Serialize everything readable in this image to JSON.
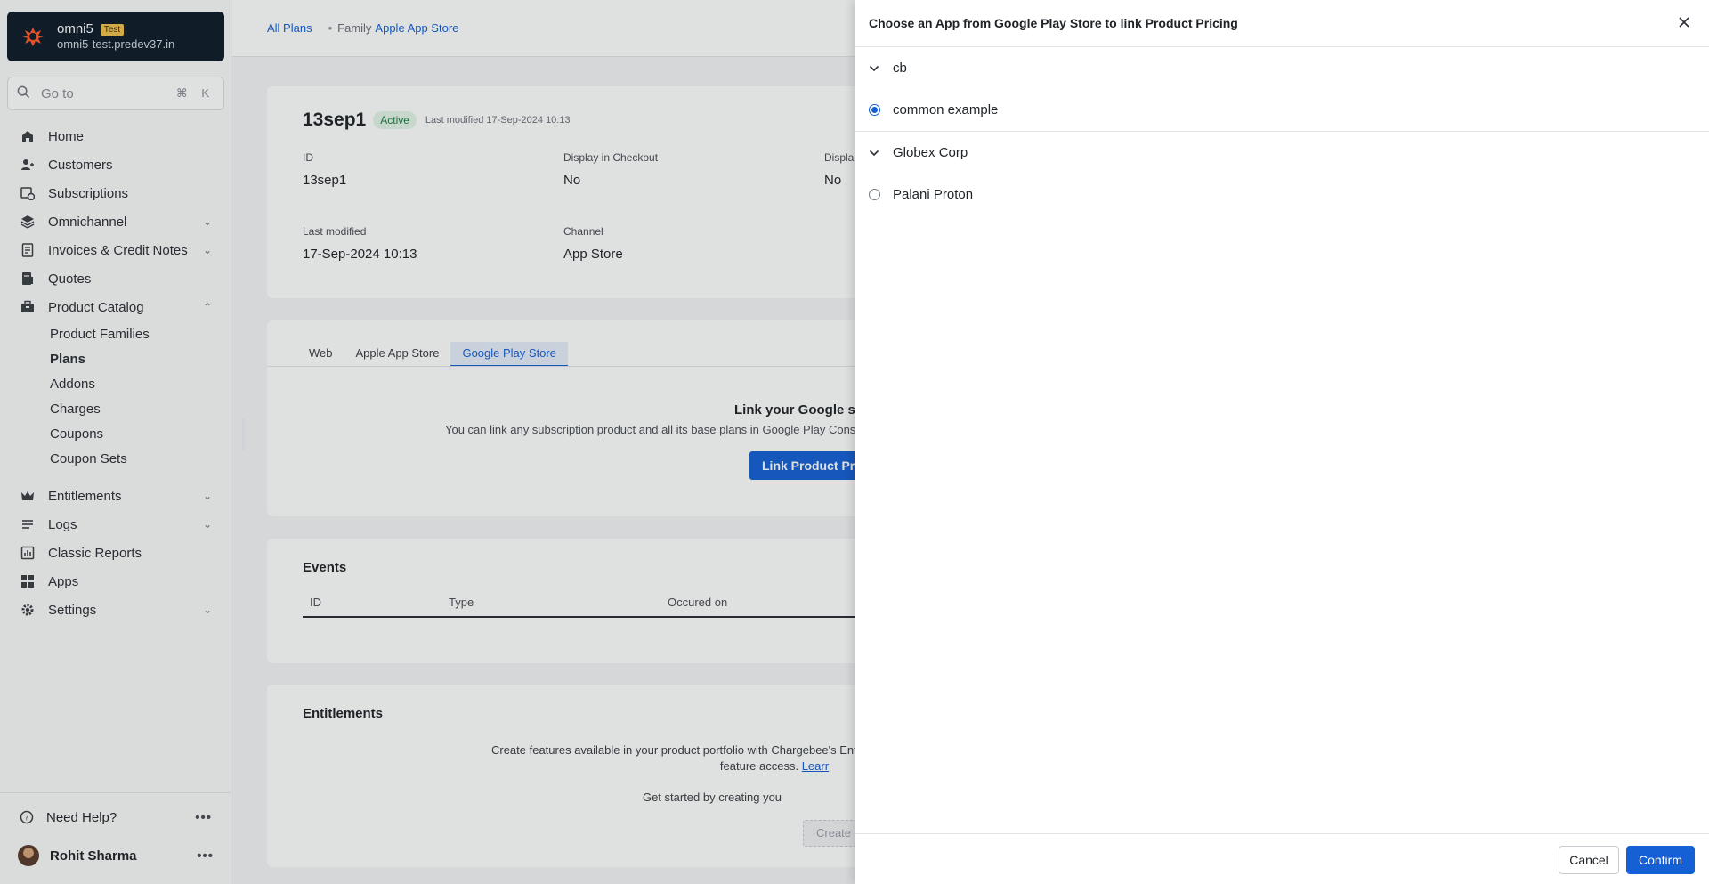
{
  "site": {
    "name": "omni5",
    "badge": "Test",
    "url": "omni5-test.predev37.in"
  },
  "search": {
    "label": "Go to",
    "shortcut": "⌘ K"
  },
  "sidebar": {
    "items": [
      {
        "label": "Home"
      },
      {
        "label": "Customers"
      },
      {
        "label": "Subscriptions"
      },
      {
        "label": "Omnichannel"
      },
      {
        "label": "Invoices & Credit Notes"
      },
      {
        "label": "Quotes"
      },
      {
        "label": "Product Catalog"
      },
      {
        "label": "Entitlements"
      },
      {
        "label": "Logs"
      },
      {
        "label": "Classic Reports"
      },
      {
        "label": "Apps"
      },
      {
        "label": "Settings"
      }
    ],
    "product_catalog_children": [
      {
        "label": "Product Families"
      },
      {
        "label": "Plans",
        "active": true
      },
      {
        "label": "Addons"
      },
      {
        "label": "Charges"
      },
      {
        "label": "Coupons"
      },
      {
        "label": "Coupon Sets"
      }
    ],
    "help": "Need Help?",
    "user": "Rohit Sharma"
  },
  "breadcrumb": {
    "all_plans": "All Plans",
    "family_label": "Family",
    "family_name": "Apple App Store"
  },
  "plan": {
    "title": "13sep1",
    "status": "Active",
    "modified": "Last modified 17-Sep-2024 10:13",
    "fields": {
      "id_label": "ID",
      "id_value": "13sep1",
      "display_checkout_label": "Display in Checkout",
      "display_checkout_value": "No",
      "display_other_label": "Displa",
      "display_other_value": "No",
      "last_modified_label": "Last modified",
      "last_modified_value": "17-Sep-2024 10:13",
      "channel_label": "Channel",
      "channel_value": "App Store"
    }
  },
  "channel_tabs": {
    "web": "Web",
    "apple": "Apple App Store",
    "google": "Google Play Store"
  },
  "google_link": {
    "title": "Link your Google subscrip",
    "subtitle": "You can link any subscription product and all its base plans in Google Play Consol",
    "button": "Link Product Pric"
  },
  "events": {
    "title": "Events",
    "col_id": "ID",
    "col_type": "Type",
    "col_occured": "Occured on"
  },
  "entitlements": {
    "title": "Entitlements",
    "line1": "Create features available in your product portfolio with Chargebee's Entitlements. Enjo",
    "line2": "feature access.",
    "link": "Learr",
    "started": "Get started by creating you",
    "button": "Create Featur"
  },
  "modal": {
    "title": "Choose an App from Google Play Store to link Product Pricing",
    "groups": [
      {
        "name": "cb",
        "apps": [
          {
            "name": "common example",
            "selected": true
          }
        ]
      },
      {
        "name": "Globex Corp",
        "apps": [
          {
            "name": "Palani Proton",
            "selected": false
          }
        ]
      }
    ],
    "cancel": "Cancel",
    "confirm": "Confirm"
  },
  "colors": {
    "accent": "#1560d4",
    "sidebar_brand_bg": "#0e1c2a",
    "status_green": "#1f7a3e"
  }
}
